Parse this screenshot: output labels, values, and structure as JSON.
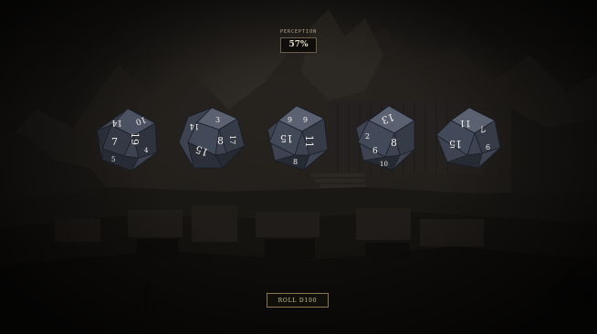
{
  "hud": {
    "label": "PERCEPTION",
    "value": "57%"
  },
  "dice": [
    {
      "faces": [
        "14",
        "10",
        "7",
        "19",
        "4",
        "5"
      ]
    },
    {
      "faces": [
        "14",
        "3",
        "15",
        "8",
        "17"
      ]
    },
    {
      "faces": [
        "9",
        "6",
        "15",
        "11",
        "8"
      ]
    },
    {
      "faces": [
        "13",
        "2",
        "6",
        "8",
        "10"
      ]
    },
    {
      "faces": [
        "11",
        "7",
        "15",
        "6"
      ]
    }
  ],
  "button": {
    "label": "ROLL D100"
  },
  "colors": {
    "die_fill": "#3d4351",
    "die_dark": "#1f232c",
    "die_light": "#5a6272",
    "numeral": "#f4f0e6",
    "accent_gold": "#8a7650"
  }
}
